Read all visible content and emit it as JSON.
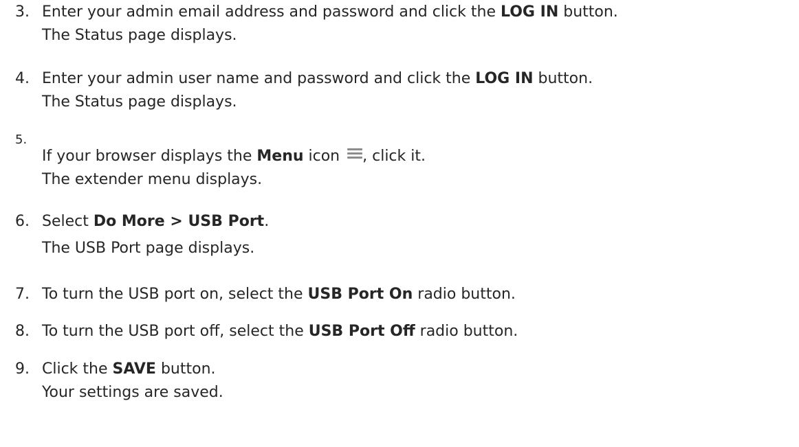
{
  "steps": [
    {
      "num": "3.",
      "line1": {
        "pre": "Enter your admin email address and password and click the ",
        "bold": "LOG IN",
        "post": " button."
      },
      "line2": "The Status page displays."
    },
    {
      "num": "4.",
      "line1": {
        "pre": "Enter your admin user name and password and click the ",
        "bold": "LOG IN",
        "post": " button."
      },
      "line2": "The Status page displays."
    },
    {
      "num": "5.",
      "line1": {
        "pre": "If your browser displays the ",
        "bold": "Menu",
        "mid": " icon ",
        "icon": "hamburger-menu-icon",
        "post": ", click it."
      },
      "line2": "The extender menu displays."
    },
    {
      "num": "6.",
      "line1": {
        "pre": "Select ",
        "bold": "Do More > USB Port",
        "post": "."
      },
      "line2": "The USB Port page displays."
    },
    {
      "num": "7.",
      "line1": {
        "pre": "To turn the USB port on, select the ",
        "bold": "USB Port On",
        "post": " radio button."
      }
    },
    {
      "num": "8.",
      "line1": {
        "pre": "To turn the USB port off, select the ",
        "bold": "USB Port Off",
        "post": " radio button."
      }
    },
    {
      "num": "9.",
      "line1": {
        "pre": "Click the ",
        "bold": "SAVE",
        "post": " button."
      },
      "line2": "Your settings are saved."
    }
  ]
}
